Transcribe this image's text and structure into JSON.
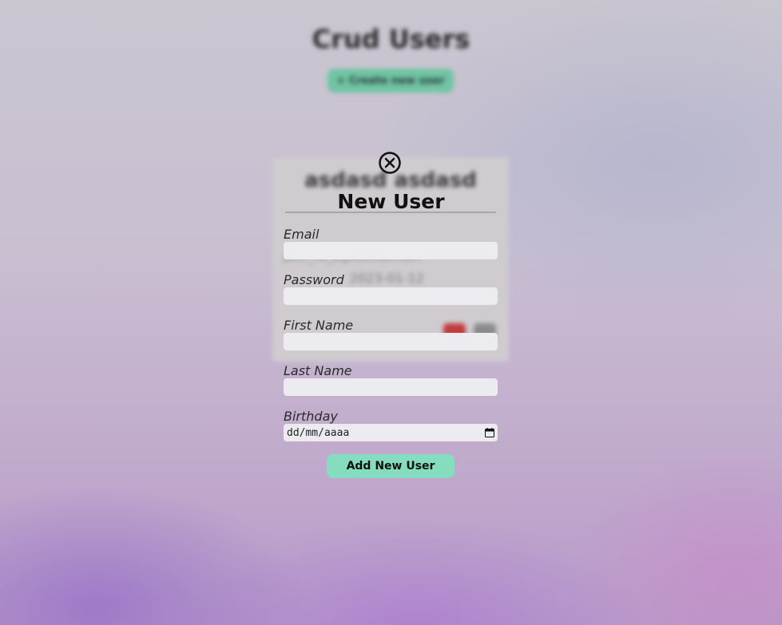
{
  "page": {
    "title": "Crud Users",
    "create_button_label": "+ Create new user"
  },
  "user_card": {
    "name": "asdasd asdasd",
    "email": "jatel_no_a@hotmail.com",
    "birthday": "2023-01-12"
  },
  "form": {
    "title": "New User",
    "email_label": "Email",
    "email_value": "",
    "password_label": "Password",
    "password_value": "",
    "first_name_label": "First Name",
    "first_name_value": "",
    "last_name_label": "Last Name",
    "last_name_value": "",
    "birthday_label": "Birthday",
    "birthday_placeholder": "dd/mm/aaaa",
    "submit_label": "Add New User"
  },
  "icons": {
    "close": "close-icon",
    "calendar": "calendar-icon",
    "delete": "trash-icon",
    "edit": "edit-icon"
  },
  "colors": {
    "accent": "#86dcbf",
    "accent_dim": "#6fc4a4",
    "delete": "#c23c3c"
  }
}
